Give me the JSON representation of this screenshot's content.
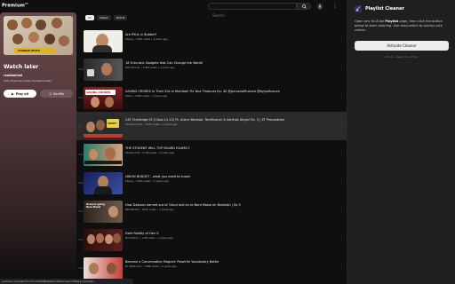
{
  "topbar": {
    "logo": "Premium",
    "search_placeholder": "Search"
  },
  "playlist": {
    "title": "Watch later",
    "owner": "rsadashiwl",
    "meta": "345 videos  No views  Updated today",
    "play_label": "Play all",
    "shuffle_label": "Shuffle",
    "thumb_banner": "CHANGE EDITS"
  },
  "chips": [
    {
      "label": "All"
    },
    {
      "label": "Videos"
    },
    {
      "label": "Shorts"
    }
  ],
  "videos": [
    {
      "index": "",
      "title": "Are PSUs in Bubble?",
      "meta": "Sanjay • 8.6K views • 2 years ago",
      "duration": "",
      "thumb": "#f0eee8"
    },
    {
      "index": "246",
      "title": "18 Futuristic Gadgets that Can Change the World!",
      "meta": "Tech Burner • 8.6M views • 2 years ago",
      "duration": "",
      "thumb": "#2b2b2b"
    },
    {
      "index": "247",
      "title": "SAVING CRORES in Their 20s in Mumbai! Fix Your Finances Ep. 42 @personalfinance @byjusfinance",
      "meta": "Rahul • 236K views • 2 years ago",
      "duration": "",
      "thumb": "#7a2222"
    },
    {
      "index": "",
      "title": "CAT Challenge 92 (Class 11-12) Ft. Ankur Warikoo, TechBurner & Sarthak Ahuja! Ep. 2 | IIT Preparation",
      "meta": "Scaried Video • 372K views • 2 years ago",
      "duration": "",
      "thumb": "#2a2a2a"
    },
    {
      "index": "249",
      "title": "THE STUDENT WILL TOP BOARD EXAMS!?",
      "meta": "Sanitay Fist • 9.3M views • 2 years ago",
      "duration": "",
      "thumb": "#d4b89a"
    },
    {
      "index": "250",
      "title": "UNION BUDGET - what you need to know!",
      "meta": "Sanjay • 342K views • 2 years ago",
      "duration": "",
      "thumb": "#1f2a55"
    },
    {
      "index": "251",
      "title": "How Dolesan earned out of Cloud and on to Bara Masal en Bulldash | Ep 5",
      "meta": "NDTVProfit • 797K views • 2 years ago",
      "duration": "",
      "thumb": "#3b2c22"
    },
    {
      "index": "252",
      "title": "Dark Reality of Gen Z",
      "meta": "Dull Mindy • 1.4M views • 2 years ago",
      "duration": "",
      "thumb": "#3a1818"
    },
    {
      "index": "253",
      "title": "Become a Conversation Magnet: Powerful Vocabulary Battle",
      "meta": "Dr. Nate Lore • 328K views • 2 years ago",
      "duration": "",
      "thumb": "#c8403a"
    }
  ],
  "thumb_texts": {
    "v3": "SAVING CRORES",
    "v4": "CENT?",
    "v7": "Doleson going Bara Masal"
  },
  "statusbar": {
    "url": "youtube.com/watch?v=Dx7wIZ9dBQ4&list=WL&index=248&pp=AAYAgIC..."
  },
  "extension": {
    "title": "Playlist Cleaner",
    "desc_prefix": "Open any YouTube ",
    "desc_bold": "Playlist",
    "desc_suffix": " page, then click the button below to start cleaning. Use drag-select to quickly pick videos.",
    "button_label": "Activate Cleaner",
    "footer": "v3.0.1 • Ready for action"
  },
  "colors": {
    "background": "#0f0f0f",
    "panel": "#1f1f1f",
    "current_row": "#2b2b2b"
  }
}
